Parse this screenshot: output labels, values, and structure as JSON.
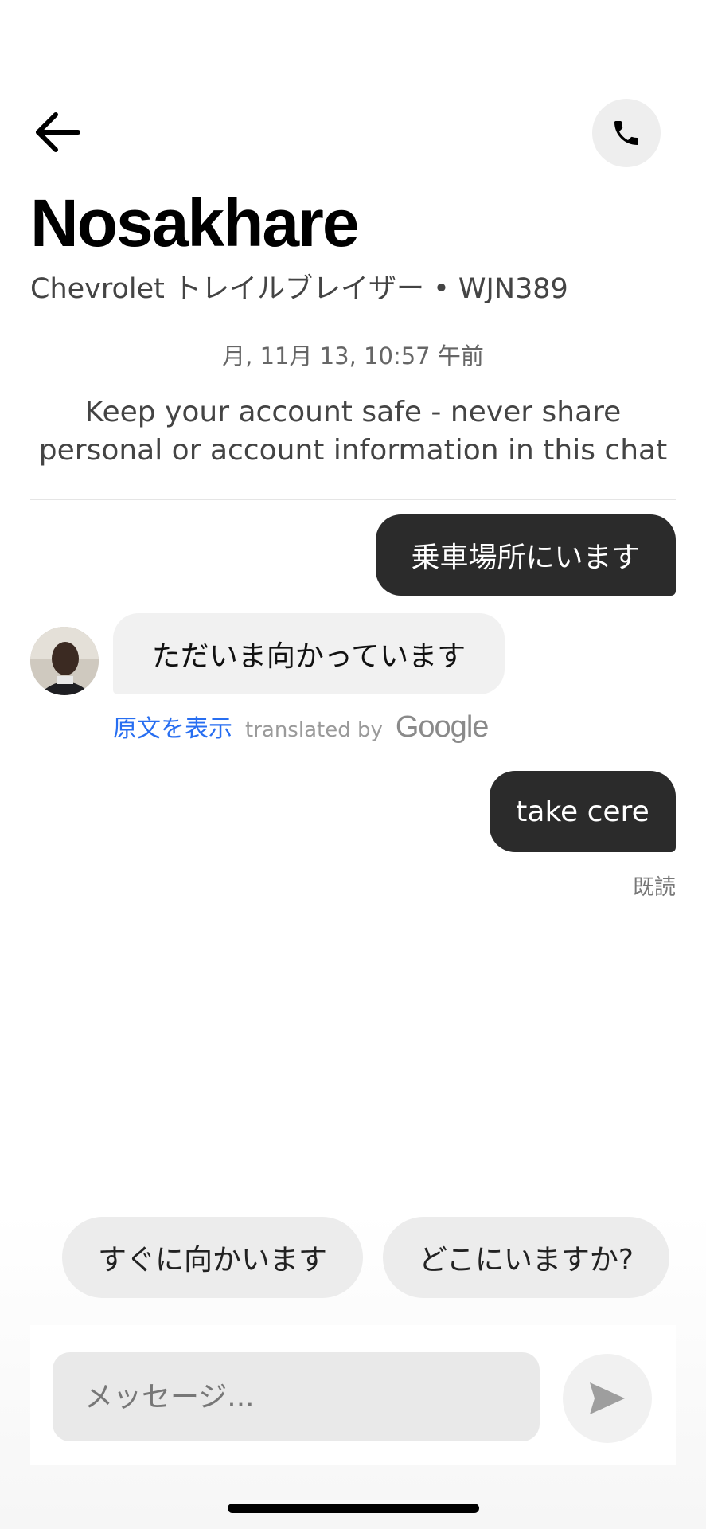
{
  "header": {
    "back_icon": "arrow-left-icon",
    "call_icon": "phone-icon",
    "driver_name": "Nosakhare",
    "vehicle_info": "Chevrolet トレイルブレイザー • WJN389"
  },
  "chat": {
    "timestamp": "月, 11月 13, 10:57 午前",
    "safety_notice": "Keep your account safe - never share personal or account information in this chat",
    "messages": [
      {
        "from": "me",
        "text": "乗車場所にいます"
      },
      {
        "from": "driver",
        "text": "ただいま向かっています",
        "show_original": "原文を表示",
        "translated_by": "translated by",
        "translator": "Google"
      },
      {
        "from": "me",
        "text": "take cere",
        "receipt": "既読"
      }
    ]
  },
  "quick_replies": [
    "すぐに向かいます",
    "どこにいますか?"
  ],
  "composer": {
    "placeholder": "メッセージ...",
    "send_icon": "send-arrow-icon"
  },
  "colors": {
    "outgoing_bubble": "#2b2b2b",
    "incoming_bubble": "#f1f1f1",
    "link_blue": "#276ef1"
  }
}
